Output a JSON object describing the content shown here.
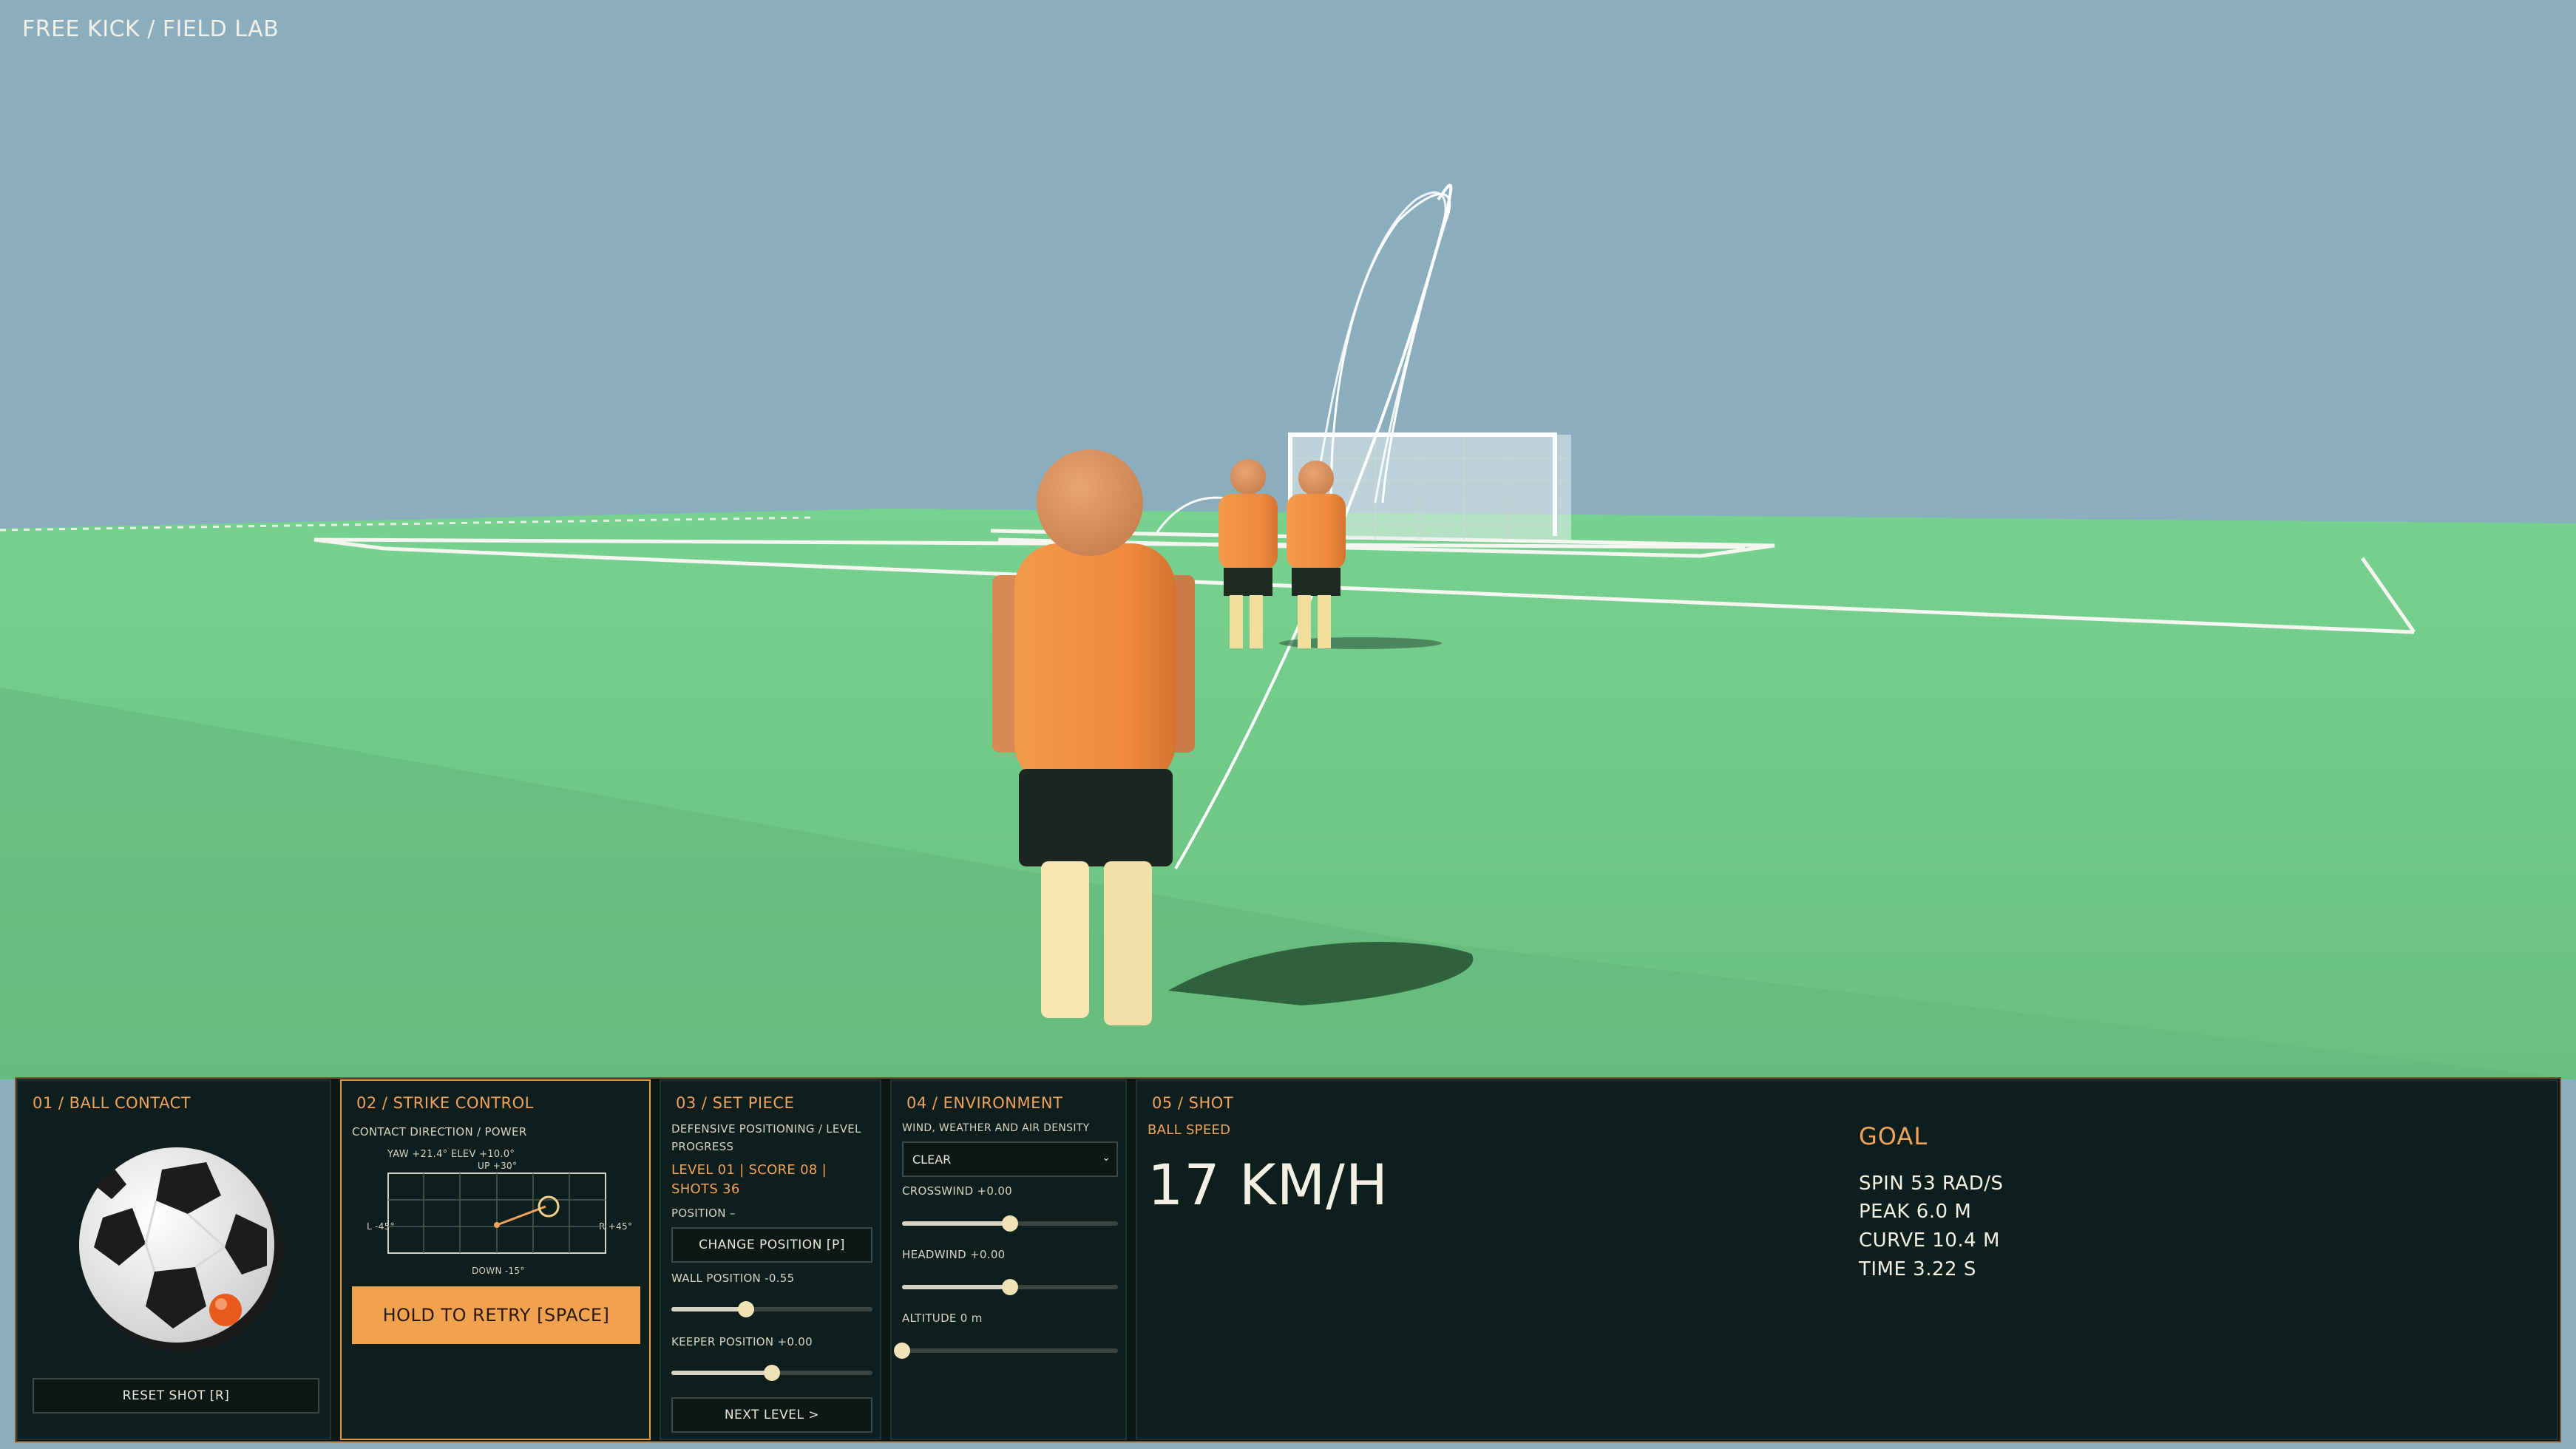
{
  "hud": {
    "title": "FREE KICK / FIELD LAB"
  },
  "ball_contact": {
    "title": "01 / BALL CONTACT",
    "reset_label": "RESET SHOT  [R]"
  },
  "strike": {
    "title": "02 / STRIKE CONTROL",
    "subtitle": "CONTACT DIRECTION / POWER",
    "readout": "YAW +21.4°   ELEV +10.0°",
    "up": "UP +30°",
    "down": "DOWN -15°",
    "left": "L -45°",
    "right": "R +45°",
    "retry_label": "HOLD TO RETRY  [SPACE]"
  },
  "set_piece": {
    "title": "03 / SET PIECE",
    "subtitle_1": "DEFENSIVE POSITIONING / LEVEL",
    "subtitle_2": "PROGRESS",
    "level_line": "LEVEL 01  |  SCORE 08  |",
    "shots_line": "SHOTS 36",
    "position": "POSITION  –",
    "change_label": "CHANGE POSITION  [P]",
    "wall_label": "WALL POSITION  -0.55",
    "wall_value": 0.37,
    "keeper_label": "KEEPER POSITION  +0.00",
    "keeper_value": 0.5,
    "next_label": "NEXT LEVEL  >"
  },
  "environment": {
    "title": "04 / ENVIRONMENT",
    "subtitle": "WIND, WEATHER AND AIR DENSITY",
    "weather": "CLEAR",
    "crosswind_label": "CROSSWIND  +0.00",
    "crosswind_value": 0.5,
    "headwind_label": "HEADWIND  +0.00",
    "headwind_value": 0.5,
    "altitude_label": "ALTITUDE  0 m",
    "altitude_value": 0.0
  },
  "shot": {
    "title": "05 / SHOT",
    "speed_label": "BALL SPEED",
    "speed": "17 KM/H",
    "result": "GOAL",
    "spin": "SPIN 53 RAD/S",
    "peak": "PEAK 6.0 M",
    "curve": "CURVE 10.4 M",
    "time": "TIME 3.22 S"
  },
  "colors": {
    "sky": "#8aaebd",
    "pitch": "#6cc584",
    "accent": "#f0a35c",
    "jersey": "#f08a3c",
    "panel": "#0e1e1c"
  }
}
